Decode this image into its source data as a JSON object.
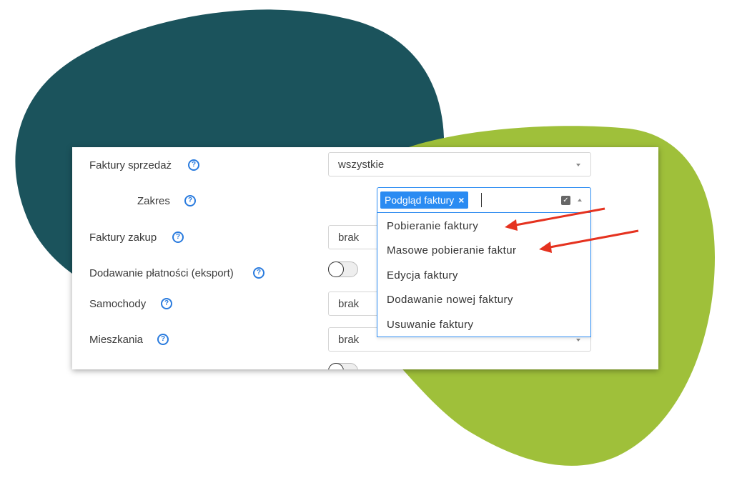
{
  "colors": {
    "blob_dark": "#1b535c",
    "blob_green": "#9fc03a",
    "accent": "#2a8bf2",
    "arrow": "#e5321f"
  },
  "form": {
    "rows": [
      {
        "label": "Faktury sprzedaż",
        "value": "wszystkie"
      },
      {
        "label": "Zakres"
      },
      {
        "label": "Faktury zakup",
        "value": "brak"
      },
      {
        "label": "Dodawanie płatności (eksport)"
      },
      {
        "label": "Samochody",
        "value": "brak"
      },
      {
        "label": "Mieszkania",
        "value": "brak"
      }
    ]
  },
  "help_glyph": "?",
  "multiselect": {
    "tag": "Podgląd faktury",
    "tag_remove": "×",
    "check_glyph": "✓",
    "options": [
      "Pobieranie faktury",
      "Masowe pobieranie faktur",
      "Edycja faktury",
      "Dodawanie nowej faktury",
      "Usuwanie faktury"
    ]
  }
}
